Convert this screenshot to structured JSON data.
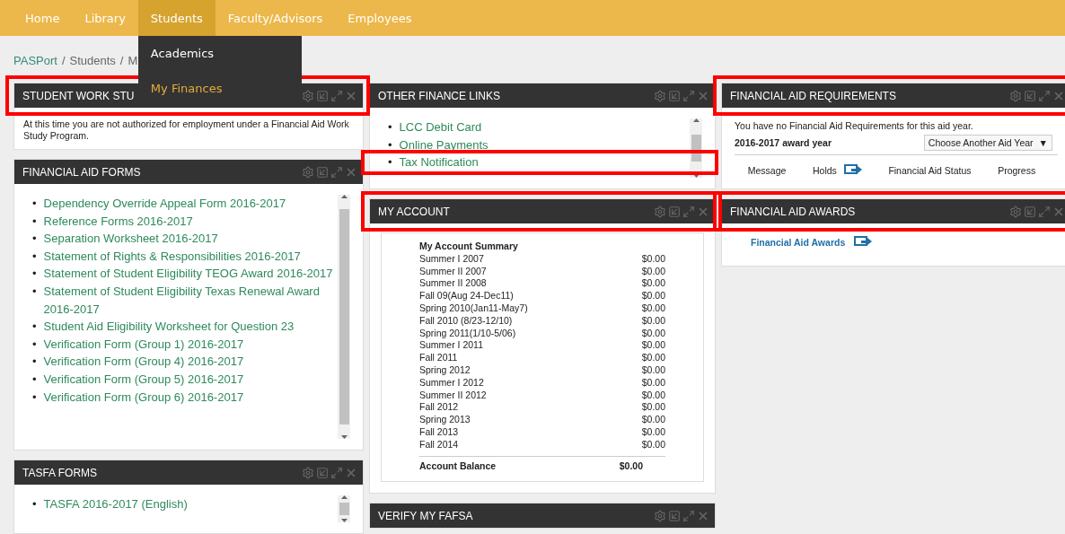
{
  "nav": {
    "items": [
      {
        "label": "Home",
        "selected": false
      },
      {
        "label": "Library",
        "selected": false
      },
      {
        "label": "Students",
        "selected": true
      },
      {
        "label": "Faculty/Advisors",
        "selected": false
      },
      {
        "label": "Employees",
        "selected": false
      }
    ],
    "dropdown": [
      {
        "label": "Academics",
        "selected": false
      },
      {
        "label": "My Finances",
        "selected": true
      }
    ]
  },
  "breadcrumb": [
    {
      "label": "PASPort"
    },
    {
      "separator": "/",
      "label": "Students"
    },
    {
      "separator": "/",
      "label": "M"
    }
  ],
  "columns": [
    [
      {
        "title": "STUDENT WORK STU",
        "highlighted": true,
        "kind": "text",
        "text": "At this time you are not authorized for employment under a Financial Aid Work Study Program."
      },
      {
        "title": "FINANCIAL AID FORMS",
        "highlighted": false,
        "kind": "links",
        "links": [
          {
            "bullet": "•",
            "label": "Dependency Override Appeal Form 2016-2017",
            "highlighted": false
          },
          {
            "bullet": "•",
            "label": "Reference Forms 2016-2017",
            "highlighted": false
          },
          {
            "bullet": "•",
            "label": "Separation Worksheet 2016-2017",
            "highlighted": false
          },
          {
            "bullet": "•",
            "label": "Statement of Rights & Responsibilities 2016-2017",
            "highlighted": false
          },
          {
            "bullet": "•",
            "label": "Statement of Student Eligibility TEOG Award 2016-2017",
            "highlighted": false
          },
          {
            "bullet": "•",
            "label": "Statement of Student Eligibility Texas Renewal Award 2016-2017",
            "highlighted": false
          },
          {
            "bullet": "•",
            "label": "Student Aid Eligibility Worksheet for Question 23",
            "highlighted": false
          },
          {
            "bullet": "•",
            "label": "Verification Form (Group 1) 2016-2017",
            "highlighted": false
          },
          {
            "bullet": "•",
            "label": "Verification Form (Group 4) 2016-2017",
            "highlighted": false
          },
          {
            "bullet": "•",
            "label": "Verification Form (Group 5) 2016-2017",
            "highlighted": false
          },
          {
            "bullet": "•",
            "label": "Verification Form (Group 6) 2016-2017",
            "highlighted": false
          }
        ]
      },
      {
        "title": "TASFA FORMS",
        "highlighted": false,
        "kind": "links",
        "links": [
          {
            "bullet": "•",
            "label": "TASFA 2016-2017 (English)",
            "highlighted": false
          }
        ]
      }
    ],
    [
      {
        "title": "OTHER FINANCE LINKS",
        "highlighted": false,
        "kind": "links",
        "links": [
          {
            "bullet": "•",
            "label": "LCC Debit Card",
            "highlighted": false
          },
          {
            "bullet": "•",
            "label": "Online Payments",
            "highlighted": false
          },
          {
            "bullet": "•",
            "label": "Tax Notification",
            "highlighted": true
          }
        ]
      },
      {
        "title": "MY ACCOUNT",
        "highlighted": true,
        "kind": "account",
        "heading": "My Account Summary",
        "rows": [
          {
            "term": "Summer I 2007",
            "amount": "$0.00"
          },
          {
            "term": "Summer II 2007",
            "amount": "$0.00"
          },
          {
            "term": "Summer II 2008",
            "amount": "$0.00"
          },
          {
            "term": "Fall 09(Aug 24-Dec11)",
            "amount": "$0.00"
          },
          {
            "term": "Spring 2010(Jan11-May7)",
            "amount": "$0.00"
          },
          {
            "term": "Fall 2010 (8/23-12/10)",
            "amount": "$0.00"
          },
          {
            "term": "Spring 2011(1/10-5/06)",
            "amount": "$0.00"
          },
          {
            "term": "Summer I 2011",
            "amount": "$0.00"
          },
          {
            "term": "Fall 2011",
            "amount": "$0.00"
          },
          {
            "term": "Spring 2012",
            "amount": "$0.00"
          },
          {
            "term": "Summer I 2012",
            "amount": "$0.00"
          },
          {
            "term": "Summer II 2012",
            "amount": "$0.00"
          },
          {
            "term": "Fall 2012",
            "amount": "$0.00"
          },
          {
            "term": "Spring 2013",
            "amount": "$0.00"
          },
          {
            "term": "Fall 2013",
            "amount": "$0.00"
          },
          {
            "term": "Fall 2014",
            "amount": "$0.00"
          }
        ],
        "balance_label": "Account Balance",
        "balance": "$0.00"
      },
      {
        "title": "VERIFY MY FAFSA",
        "highlighted": false,
        "kind": "empty"
      }
    ],
    [
      {
        "title": "FINANCIAL AID REQUIREMENTS",
        "highlighted": true,
        "kind": "requirements",
        "message": "You have no Financial Aid Requirements for this aid year.",
        "award_year": "2016-2017 award year",
        "select": "Choose Another Aid Year",
        "select_arrow": "▼",
        "tabs": [
          {
            "label": "Message",
            "icon": false
          },
          {
            "label": "Holds",
            "icon": true
          },
          {
            "label": "Financial Aid Status",
            "icon": false
          },
          {
            "label": "Progress",
            "icon": false
          }
        ]
      },
      {
        "title": "FINANCIAL AID AWARDS",
        "highlighted": true,
        "kind": "awards",
        "link": "Financial Aid Awards"
      }
    ]
  ]
}
